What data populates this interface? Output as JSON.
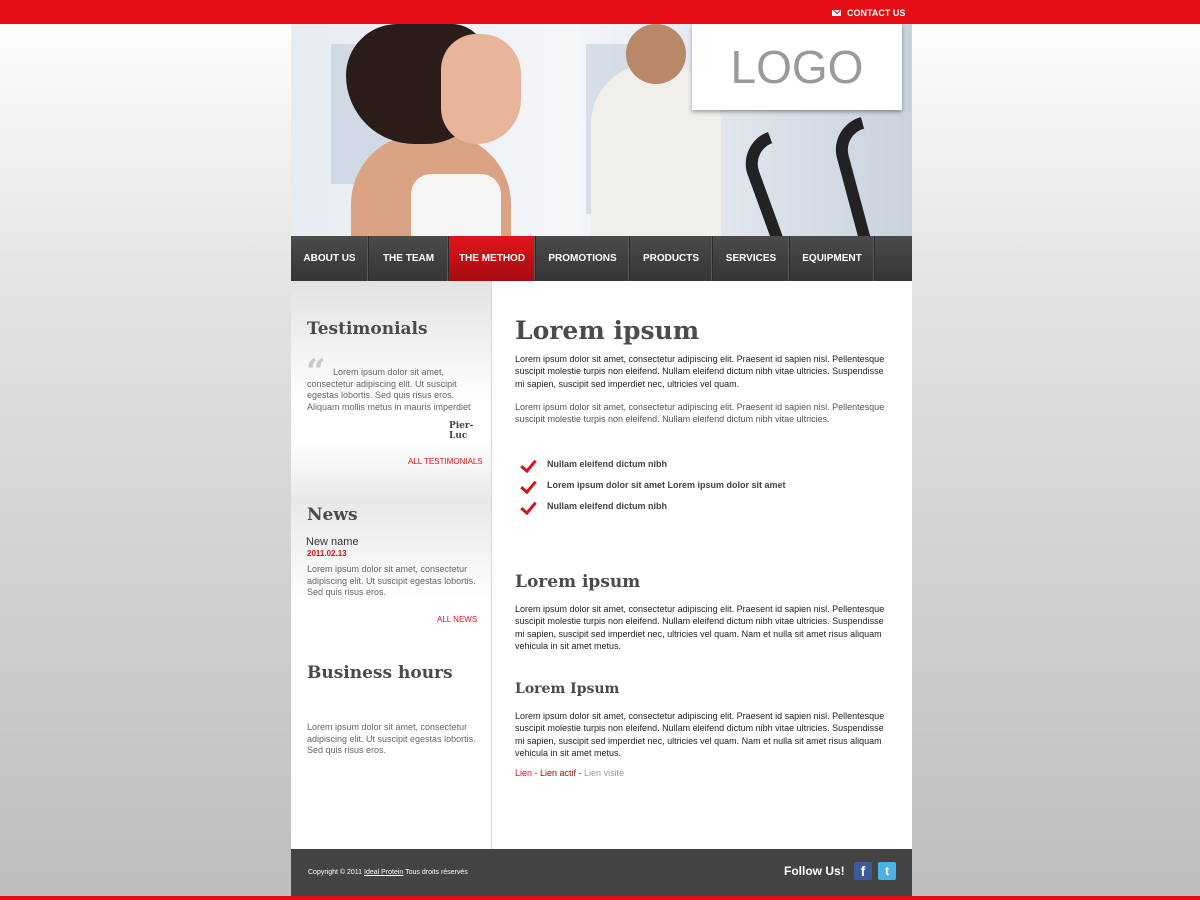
{
  "topbar": {
    "contact_label": "CONTACT US"
  },
  "header": {
    "logo_text": "LOGO"
  },
  "nav": {
    "items": [
      {
        "label": "ABOUT US"
      },
      {
        "label": "THE TEAM"
      },
      {
        "label": "THE METHOD"
      },
      {
        "label": "PROMOTIONS"
      },
      {
        "label": "PRODUCTS"
      },
      {
        "label": "SERVICES"
      },
      {
        "label": "EQUIPMENT"
      }
    ],
    "active_label": "THE METHOD"
  },
  "sidebar": {
    "testimonials": {
      "title": "Testimonials",
      "quote_mark": "“",
      "text": "Lorem ipsum dolor sit amet, consectetur adipiscing elit. Ut suscipit egestas lobortis. Sed quis risus eros. Aliquam mollis metus in mauris imperdiet",
      "author": "Pier-Luc",
      "link": "ALL TESTIMONIALS"
    },
    "news": {
      "title": "News",
      "item_name": "New name",
      "item_date": "2011.02.13",
      "text": "Lorem ipsum dolor sit amet, consectetur adipiscing elit. Ut suscipit egestas lobortis. Sed quis risus eros.",
      "link": "ALL NEWS"
    },
    "hours": {
      "title": "Business hours",
      "text": "Lorem ipsum dolor sit amet, consectetur adipiscing elit. Ut suscipit egestas lobortis. Sed quis risus eros."
    }
  },
  "main": {
    "title": "Lorem ipsum",
    "para1": "Lorem ipsum dolor sit amet, consectetur adipiscing elit. Praesent id sapien nisl. Pellentesque suscipit molestie turpis non eleifend. Nullam eleifend dictum nibh vitae ultricies. Suspendisse mi sapien, suscipit sed imperdiet nec, ultricies vel quam.",
    "para2": "Lorem ipsum dolor sit amet, consectetur adipiscing elit. Praesent id sapien nisl. Pellentesque suscipit molestie turpis non eleifend. Nullam eleifend dictum nibh vitae ultricies.",
    "checklist": [
      "Nullam eleifend dictum nibh",
      "Lorem ipsum dolor sit amet Lorem ipsum dolor sit amet",
      "Nullam eleifend dictum nibh"
    ],
    "section2_title": "Lorem ipsum",
    "section2_text": "Lorem ipsum dolor sit amet, consectetur adipiscing elit. Praesent id sapien nisl. Pellentesque suscipit molestie turpis non eleifend. Nullam eleifend dictum nibh vitae ultricies. Suspendisse mi sapien, suscipit sed imperdiet nec, ultricies vel quam. Nam et nulla sit amet risus aliquam vehicula in sit amet metus.",
    "section3_title": "Lorem Ipsum",
    "section3_text": "Lorem ipsum dolor sit amet, consectetur adipiscing elit. Praesent id sapien nisl. Pellentesque suscipit molestie turpis non eleifend. Nullam eleifend dictum nibh vitae ultricies. Suspendisse mi sapien, suscipit sed imperdiet nec, ultricies vel quam. Nam et nulla sit amet risus aliquam vehicula in sit amet metus.",
    "links": {
      "link": "Lien",
      "active": "Lien actif",
      "visited": "Lien visité",
      "separator": " - "
    }
  },
  "footer": {
    "copyright_prefix": "Copyright © 2011 ",
    "copyright_link": "Ideal Protein",
    "copyright_suffix": " Tous droits réservés",
    "follow_label": "Follow Us!",
    "facebook_glyph": "f",
    "twitter_glyph": "t"
  },
  "colors": {
    "brand_red": "#e60c14",
    "nav_dark": "#3d3d3d",
    "footer_dark": "#434343"
  }
}
